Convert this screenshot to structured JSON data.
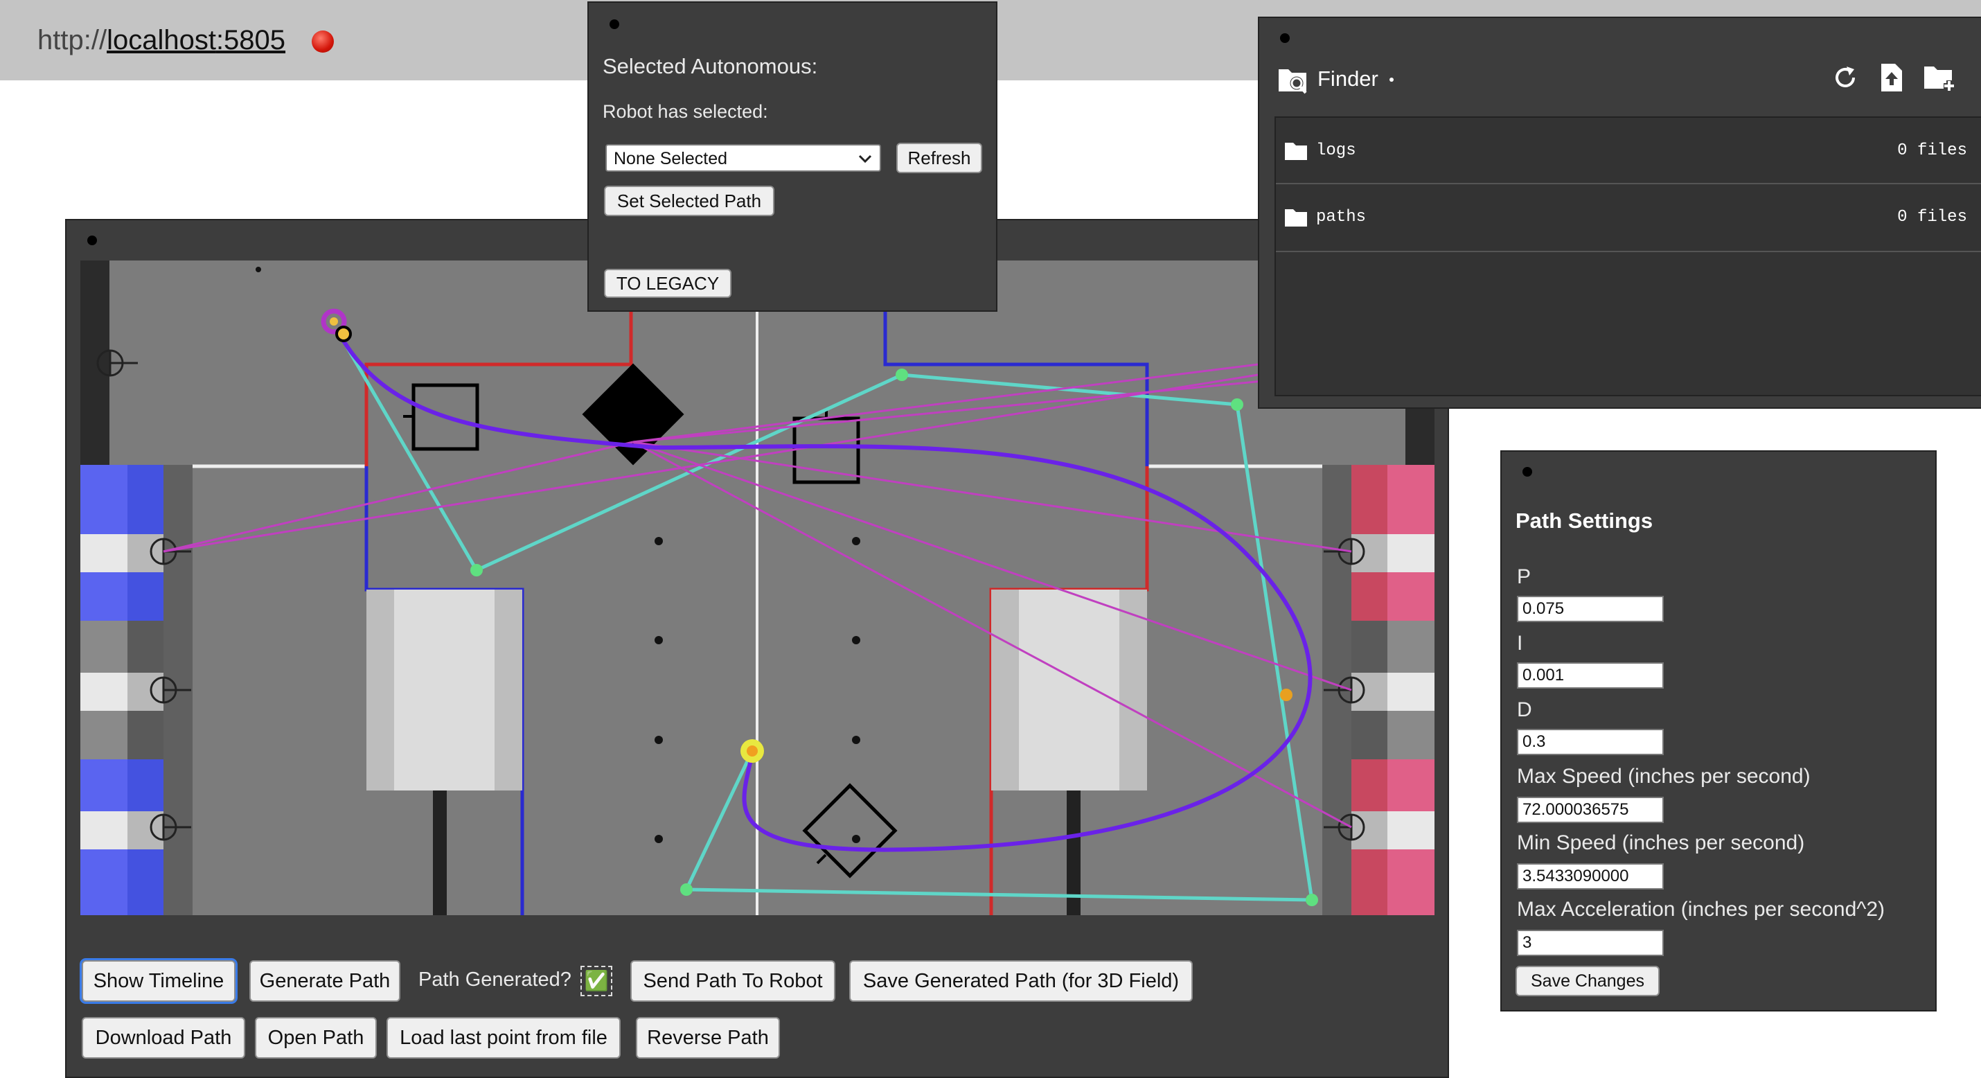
{
  "browser": {
    "url_prefix": "http://",
    "url_host": "localhost",
    "url_port": ":5805"
  },
  "autonomous_panel": {
    "title": "Selected Autonomous:",
    "robot_label": "Robot has selected:",
    "select_value": "None Selected",
    "refresh_label": "Refresh",
    "set_path_label": "Set Selected Path",
    "legacy_label": "TO LEGACY"
  },
  "finder": {
    "title": "Finder",
    "folders": [
      {
        "name": "logs",
        "count": "0 files"
      },
      {
        "name": "paths",
        "count": "0 files"
      }
    ]
  },
  "path_settings": {
    "title": "Path Settings",
    "fields": [
      {
        "label": "P",
        "value": "0.075"
      },
      {
        "label": "I",
        "value": "0.001"
      },
      {
        "label": "D",
        "value": "0.3"
      },
      {
        "label": "Max Speed (inches per second)",
        "value": "72.000036575"
      },
      {
        "label": "Min Speed (inches per second)",
        "value": "3.5433090000"
      },
      {
        "label": "Max Acceleration (inches per second^2)",
        "value": "3"
      }
    ],
    "save_label": "Save Changes"
  },
  "toolbar": {
    "show_timeline": "Show Timeline",
    "generate_path": "Generate Path",
    "path_generated_label": "Path Generated?",
    "path_generated_check": "✅",
    "send_path": "Send Path To Robot",
    "save_generated": "Save Generated Path (for 3D Field)",
    "download_path": "Download Path",
    "open_path": "Open Path",
    "load_last_point": "Load last point from file",
    "reverse_path": "Reverse Path"
  },
  "colors": {
    "path_curve": "#6a22e8",
    "control_polygon": "#5fd6c8",
    "ray_lines": "#c040c0",
    "blue_alliance": "#2a2ad0",
    "red_alliance": "#d02a2a"
  }
}
